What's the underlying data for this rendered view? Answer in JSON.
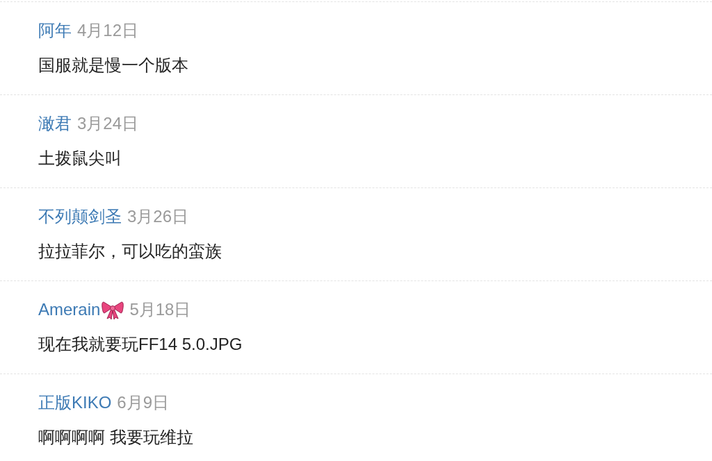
{
  "comments": [
    {
      "user": "阿年",
      "bow": false,
      "date": "4月12日",
      "text": "国服就是慢一个版本"
    },
    {
      "user": "澉君",
      "bow": false,
      "date": "3月24日",
      "text": "土拨鼠尖叫"
    },
    {
      "user": "不列颠剑圣",
      "bow": false,
      "date": "3月26日",
      "text": "拉拉菲尔，可以吃的蛮族"
    },
    {
      "user": "Amerain",
      "bow": true,
      "date": "5月18日",
      "text": "现在我就要玩FF14 5.0.JPG"
    },
    {
      "user": "正版KIKO",
      "bow": false,
      "date": "6月9日",
      "text": "啊啊啊啊 我要玩维拉"
    }
  ]
}
